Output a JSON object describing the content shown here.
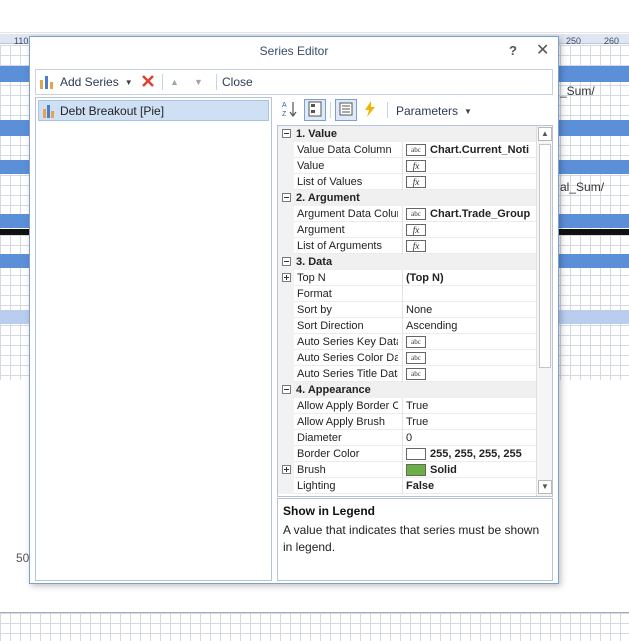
{
  "background": {
    "ruler_left": "110",
    "ruler_right": [
      "250",
      "260"
    ],
    "fragments": [
      "_Sum/",
      "al_Sum/"
    ],
    "left_number": "50"
  },
  "dialog": {
    "title": "Series Editor",
    "help_label": "?",
    "close_label": "✕"
  },
  "toolbar": {
    "add_series_label": "Add Series",
    "close_label": "Close"
  },
  "series_list": [
    {
      "label": "Debt Breakout [Pie]"
    }
  ],
  "right_toolbar": {
    "parameters_label": "Parameters"
  },
  "property_grid": {
    "rows": [
      {
        "kind": "cat",
        "label": "1. Value",
        "expander": "minus"
      },
      {
        "kind": "prop",
        "label": "Value Data Column",
        "icon": "abc",
        "value": "Chart.Current_Noti",
        "bold": true
      },
      {
        "kind": "prop",
        "label": "Value",
        "icon": "fx",
        "value": ""
      },
      {
        "kind": "prop",
        "label": "List of Values",
        "icon": "fx",
        "value": ""
      },
      {
        "kind": "cat",
        "label": "2. Argument",
        "expander": "minus"
      },
      {
        "kind": "prop",
        "label": "Argument Data Colun",
        "icon": "abc",
        "value": "Chart.Trade_Group",
        "bold": true
      },
      {
        "kind": "prop",
        "label": "Argument",
        "icon": "fx",
        "value": ""
      },
      {
        "kind": "prop",
        "label": "List of Arguments",
        "icon": "fx",
        "value": ""
      },
      {
        "kind": "cat",
        "label": "3. Data",
        "expander": "minus"
      },
      {
        "kind": "prop",
        "label": "Top N",
        "value": "(Top N)",
        "bold": true,
        "expander": "plus"
      },
      {
        "kind": "prop",
        "label": "Format",
        "value": ""
      },
      {
        "kind": "prop",
        "label": "Sort by",
        "value": "None"
      },
      {
        "kind": "prop",
        "label": "Sort Direction",
        "value": "Ascending"
      },
      {
        "kind": "prop",
        "label": "Auto Series Key Data",
        "icon": "abc",
        "value": ""
      },
      {
        "kind": "prop",
        "label": "Auto Series Color Da",
        "icon": "abc",
        "value": ""
      },
      {
        "kind": "prop",
        "label": "Auto Series Title Data",
        "icon": "abc",
        "value": ""
      },
      {
        "kind": "cat",
        "label": "4. Appearance",
        "expander": "minus"
      },
      {
        "kind": "prop",
        "label": "Allow Apply Border C",
        "value": "True"
      },
      {
        "kind": "prop",
        "label": "Allow Apply Brush",
        "value": "True"
      },
      {
        "kind": "prop",
        "label": "Diameter",
        "value": "0"
      },
      {
        "kind": "prop",
        "label": "Border Color",
        "swatch": "#ffffff",
        "value": "255, 255, 255, 255",
        "bold": true
      },
      {
        "kind": "prop",
        "label": "Brush",
        "swatch": "#6bb045",
        "value": "Solid",
        "bold": true,
        "expander": "plus"
      },
      {
        "kind": "prop",
        "label": "Lighting",
        "value": "False",
        "bold": true
      }
    ]
  },
  "description": {
    "title": "Show in Legend",
    "text": "A value that indicates that series must be shown in legend."
  },
  "colors": {
    "accent": "#3a4a68",
    "selection": "#cfe0f5",
    "brush_swatch": "#6bb045"
  },
  "icons": {
    "add_series": "chart-bar-icon",
    "remove": "red-x-icon",
    "move_up": "triangle-up-icon",
    "move_down": "triangle-down-icon",
    "sort_alpha": "sort-az-icon",
    "categorized": "categorized-icon",
    "properties": "properties-icon",
    "events": "lightning-icon"
  }
}
